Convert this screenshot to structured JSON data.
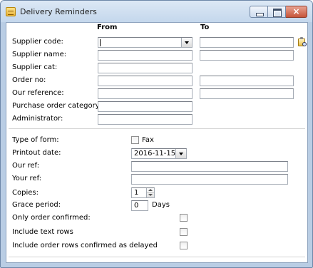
{
  "window": {
    "title": "Delivery Reminders",
    "close_glyph": "×"
  },
  "columns": {
    "from": "From",
    "to": "To"
  },
  "labels": {
    "supplier_code": "Supplier code:",
    "supplier_name": "Supplier name:",
    "supplier_cat": "Supplier cat:",
    "order_no": "Order no:",
    "our_reference": "Our reference:",
    "purchase_order_category": "Purchase order category:",
    "administrator": "Administrator:",
    "type_of_form": "Type of form:",
    "printout_date": "Printout date:",
    "our_ref": "Our ref:",
    "your_ref": "Your ref:",
    "copies": "Copies:",
    "grace_period": "Grace period:",
    "only_order_confirmed": "Only order confirmed:",
    "include_text_rows": "Include text rows",
    "include_delayed": "Include order rows confirmed as delayed"
  },
  "values": {
    "supplier_code_from": "",
    "supplier_code_to": "",
    "supplier_name_from": "",
    "supplier_name_to": "",
    "supplier_cat": "",
    "order_no_from": "",
    "order_no_to": "",
    "our_reference_from": "",
    "our_reference_to": "",
    "purchase_order_category": "",
    "administrator": "",
    "fax_checked": false,
    "fax_label": "Fax",
    "printout_date": "2016-11-15",
    "our_ref": "",
    "your_ref": "",
    "copies": "1",
    "grace_period": "0",
    "grace_unit": "Days",
    "only_order_confirmed_checked": false,
    "include_text_rows_checked": false,
    "include_delayed_checked": false
  },
  "icons": {
    "app": "clipboard-icon",
    "lookup": "lookup-icon",
    "dropdown": "chevron-down-icon"
  }
}
